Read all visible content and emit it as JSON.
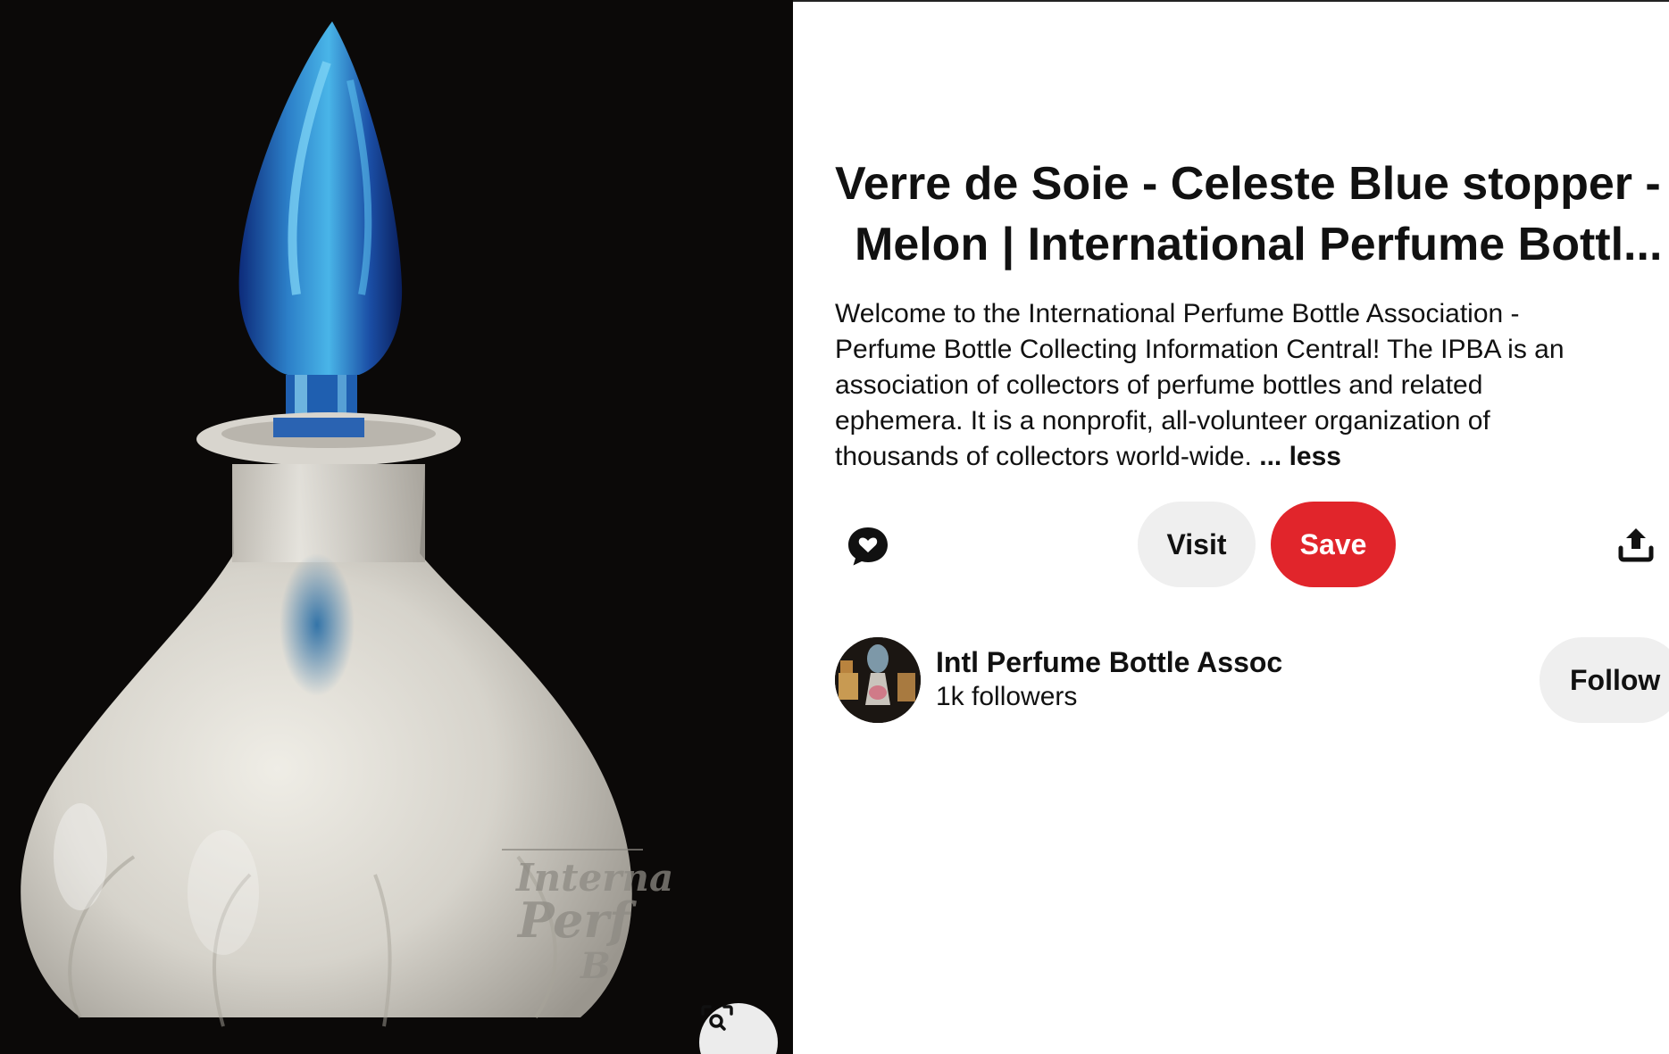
{
  "image": {
    "alt": "Verre de Soie perfume bottle with Celeste Blue stopper",
    "watermark_lines": [
      "Interna",
      "Perf",
      "B"
    ]
  },
  "pin": {
    "title_line1": "Verre de Soie - Celeste Blue stopper -",
    "title_line2": "Melon | International Perfume Bottl...",
    "description_lines": [
      "Welcome to the International Perfume Bottle Association -",
      "Perfume Bottle Collecting Information Central! The IPBA is an",
      "association of collectors of perfume bottles and related",
      "ephemera. It is a nonprofit, all-volunteer organization of",
      "thousands of collectors world-wide."
    ],
    "less_label": "... less"
  },
  "actions": {
    "comment_icon": "heart-speech-bubble-icon",
    "visit_label": "Visit",
    "save_label": "Save",
    "share_icon": "share-upload-icon",
    "visual_search_icon": "visual-search-icon"
  },
  "creator": {
    "name": "Intl Perfume Bottle Assoc",
    "followers": "1k followers",
    "follow_label": "Follow"
  },
  "colors": {
    "save_red": "#e1252b",
    "button_gray": "#efefef",
    "image_background": "#0b0908",
    "text": "#111111"
  }
}
